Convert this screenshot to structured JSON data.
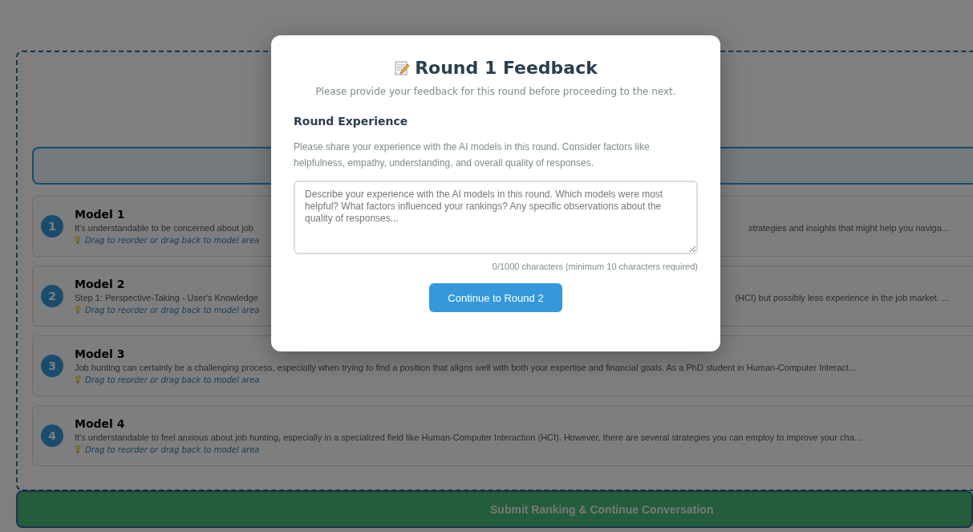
{
  "models": [
    {
      "rank": "1",
      "name": "Model 1",
      "text_left": "It's understandable to be concerned about job",
      "text_right": "strategies and insights that might help you naviga...",
      "hint": "Drag to reorder or drag back to model area"
    },
    {
      "rank": "2",
      "name": "Model 2",
      "text_left": "Step 1: Perspective-Taking - User's Knowledge",
      "text_right": "(HCI) but possibly less experience in the job market. ...",
      "hint": "Drag to reorder or drag back to model area"
    },
    {
      "rank": "3",
      "name": "Model 3",
      "text": "Job hunting can certainly be a challenging process, especially when trying to find a position that aligns well with both your expertise and financial goals. As a PhD student in Human-Computer Interact...",
      "hint": "Drag to reorder or drag back to model area"
    },
    {
      "rank": "4",
      "name": "Model 4",
      "text": "It's understandable to feel anxious about job hunting, especially in a specialized field like Human-Computer Interaction (HCI). However, there are several strategies you can employ to improve your cha...",
      "hint": "Drag to reorder or drag back to model area"
    }
  ],
  "submit_button": {
    "label": "Submit Ranking & Continue Conversation",
    "disabled": true
  },
  "modal": {
    "title": "Round 1 Feedback",
    "subtitle": "Please provide your feedback for this round before proceeding to the next.",
    "section_title": "Round Experience",
    "section_text": "Please share your experience with the AI models in this round. Consider factors like helpfulness, empathy, understanding, and overall quality of responses.",
    "textarea": {
      "placeholder": "Describe your experience with the AI models in this round. Which models were most helpful? What factors influenced your rankings? Any specific observations about the quality of responses..."
    },
    "counter": "0/1000 characters (minimum 10 characters required)",
    "button": "Continue to Round 2"
  }
}
